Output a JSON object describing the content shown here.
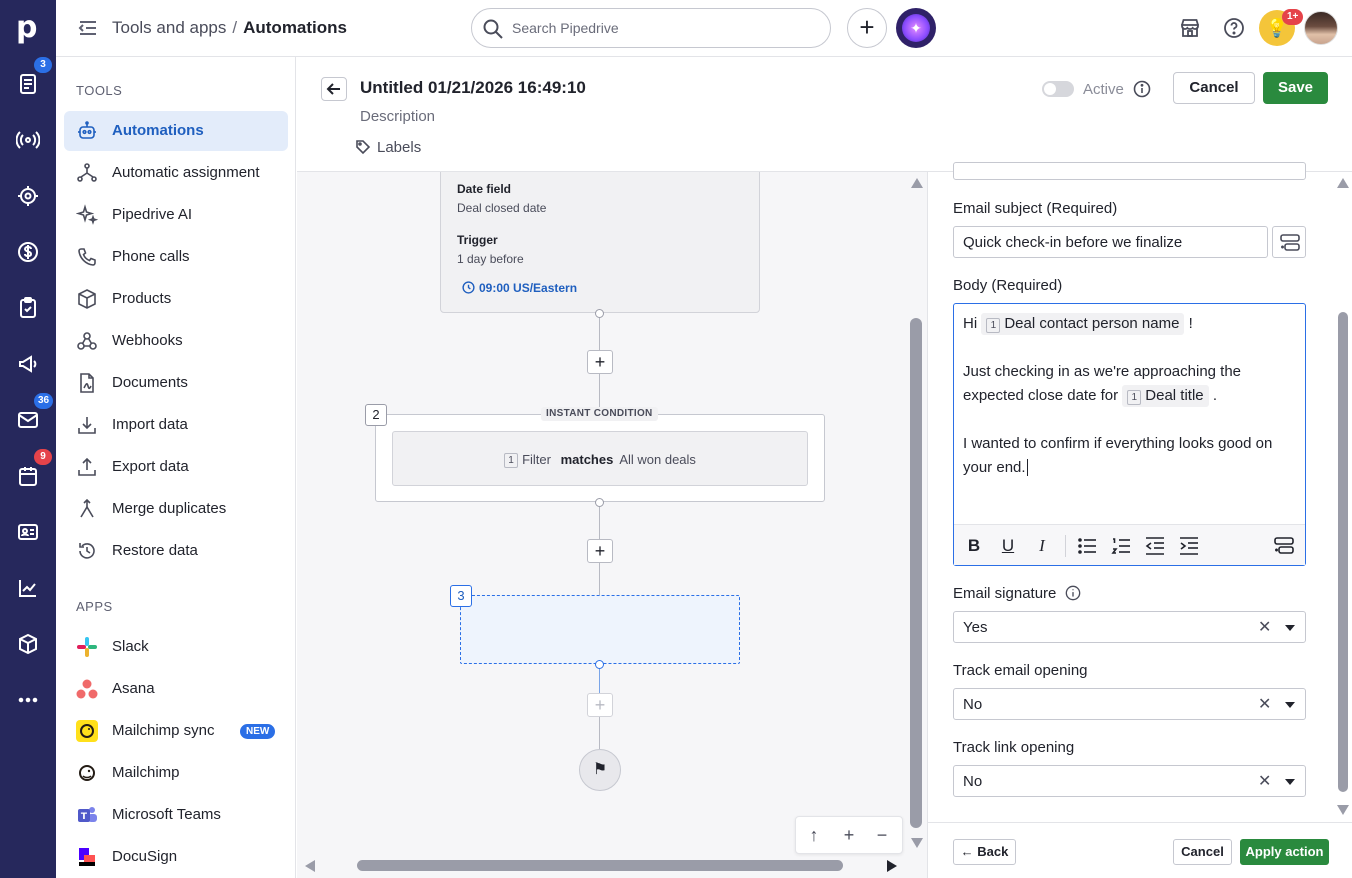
{
  "app": {
    "logo_letter": "p"
  },
  "rail": {
    "badges": {
      "leads": "3",
      "mail": "36",
      "activities": "9"
    }
  },
  "header": {
    "breadcrumb_parent": "Tools and apps",
    "breadcrumb_sep": "/",
    "breadcrumb_current": "Automations",
    "search_placeholder": "Search Pipedrive",
    "add_label": "+",
    "tips_badge": "1+"
  },
  "sidebar": {
    "tools_title": "TOOLS",
    "tools": [
      {
        "label": "Automations",
        "icon": "robot-icon"
      },
      {
        "label": "Automatic assignment",
        "icon": "assignment-icon"
      },
      {
        "label": "Pipedrive AI",
        "icon": "sparkles-icon"
      },
      {
        "label": "Phone calls",
        "icon": "phone-icon"
      },
      {
        "label": "Products",
        "icon": "box-icon"
      },
      {
        "label": "Webhooks",
        "icon": "webhook-icon"
      },
      {
        "label": "Documents",
        "icon": "document-icon"
      },
      {
        "label": "Import data",
        "icon": "import-icon"
      },
      {
        "label": "Export data",
        "icon": "export-icon"
      },
      {
        "label": "Merge duplicates",
        "icon": "merge-icon"
      },
      {
        "label": "Restore data",
        "icon": "restore-icon"
      }
    ],
    "apps_title": "APPS",
    "apps": [
      {
        "label": "Slack",
        "color": "#e01e5a"
      },
      {
        "label": "Asana",
        "color": "#f06a6a"
      },
      {
        "label": "Mailchimp sync",
        "color": "#ffe01b",
        "badge": "NEW"
      },
      {
        "label": "Mailchimp",
        "color": "#241c15"
      },
      {
        "label": "Microsoft Teams",
        "color": "#5059c9"
      },
      {
        "label": "DocuSign",
        "color": "#d5232a"
      }
    ]
  },
  "editor": {
    "title": "Untitled 01/21/2026 16:49:10",
    "description": "Description",
    "labels": "Labels",
    "active_label": "Active",
    "cancel": "Cancel",
    "save": "Save"
  },
  "canvas": {
    "trigger": {
      "date_field_label": "Date field",
      "date_field_value": "Deal closed date",
      "trigger_label": "Trigger",
      "trigger_value": "1 day before",
      "time": "09:00 US/Eastern"
    },
    "condition": {
      "step": "2",
      "tag": "INSTANT CONDITION",
      "chip_num": "1",
      "filter_word": "Filter",
      "matches": "matches",
      "filter_value": "All won deals"
    },
    "action": {
      "step": "3"
    },
    "zoom": {
      "up": "↑",
      "plus": "+",
      "minus": "−"
    }
  },
  "panel": {
    "email_subject_label": "Email subject (Required)",
    "email_subject_value": "Quick check-in before we finalize",
    "body_label": "Body (Required)",
    "body": {
      "greeting": "Hi",
      "chip1_num": "1",
      "chip1": "Deal contact person name",
      "exclaim": "!",
      "line2": "Just checking in as we're approaching the expected close date for",
      "chip2_num": "1",
      "chip2": "Deal title",
      "period": ".",
      "line3": "I wanted to confirm if everything looks good on your end."
    },
    "signature_label": "Email signature",
    "signature_value": "Yes",
    "track_open_label": "Track email opening",
    "track_open_value": "No",
    "track_link_label": "Track link opening",
    "track_link_value": "No",
    "back": "Back",
    "cancel": "Cancel",
    "apply": "Apply action"
  }
}
